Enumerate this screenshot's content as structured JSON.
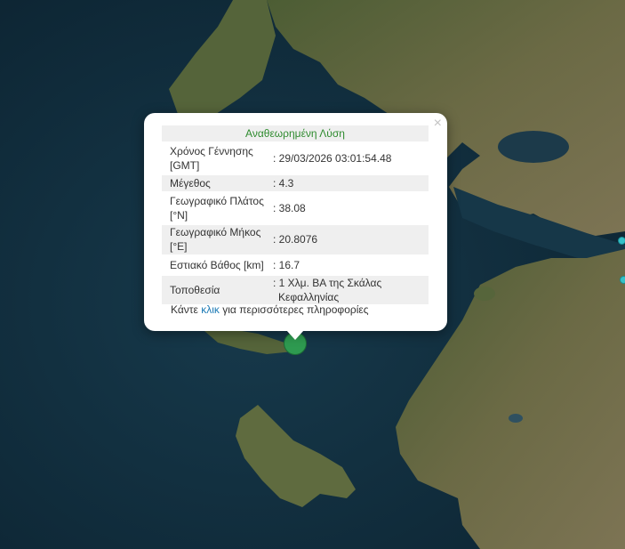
{
  "popup": {
    "title": "Αναθεωρημένη Λύση",
    "close_label": "×",
    "rows": [
      {
        "label_line1": "Χρόνος Γέννησης",
        "label_line2": "[GMT]",
        "value_line1": ": 29/03/2026 03:01:54.48",
        "value_line2": ""
      },
      {
        "label_line1": "Μέγεθος",
        "label_line2": "",
        "value_line1": ": 4.3",
        "value_line2": ""
      },
      {
        "label_line1": "Γεωγραφικό Πλάτος",
        "label_line2": "[°N]",
        "value_line1": ": 38.08",
        "value_line2": ""
      },
      {
        "label_line1": "Γεωγραφικό Μήκος",
        "label_line2": "[°E]",
        "value_line1": ": 20.8076",
        "value_line2": ""
      },
      {
        "label_line1": "Εστιακό Βάθος [km]",
        "label_line2": "",
        "value_line1": ": 16.7",
        "value_line2": ""
      },
      {
        "label_line1": "Τοποθεσία",
        "label_line2": "",
        "value_line1": ": 1 Χλμ. ΒΑ της Σκάλας",
        "value_line2": "Κεφαλληνίας"
      }
    ],
    "more_prefix": "Κάντε ",
    "more_link": "κλικ",
    "more_suffix": " για περισσότερες πληροφορίες"
  },
  "colors": {
    "sea": "#12303f",
    "land": "#5b6a3c",
    "marker": "#2e9a50",
    "secondary_marker": "#35c1c9",
    "title_green": "#2e8b2e",
    "link_blue": "#1c7ab5"
  }
}
